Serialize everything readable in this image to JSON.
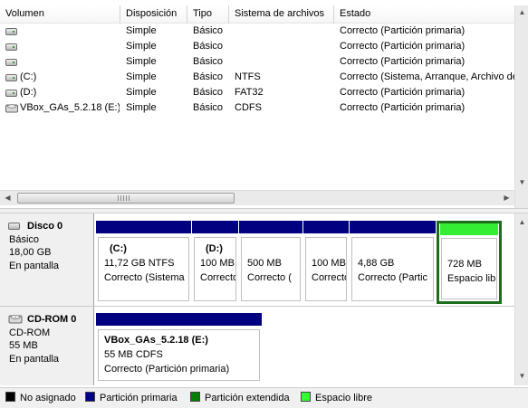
{
  "volume_table": {
    "columns": [
      "Volumen",
      "Disposición",
      "Tipo",
      "Sistema de archivos",
      "Estado"
    ],
    "rows": [
      {
        "icon": "drive-icon",
        "volume": "",
        "layout": "Simple",
        "type": "Básico",
        "fs": "",
        "status": "Correcto (Partición primaria)"
      },
      {
        "icon": "drive-icon",
        "volume": "",
        "layout": "Simple",
        "type": "Básico",
        "fs": "",
        "status": "Correcto (Partición primaria)"
      },
      {
        "icon": "drive-icon",
        "volume": "",
        "layout": "Simple",
        "type": "Básico",
        "fs": "",
        "status": "Correcto (Partición primaria)"
      },
      {
        "icon": "drive-icon",
        "volume": "(C:)",
        "layout": "Simple",
        "type": "Básico",
        "fs": "NTFS",
        "status": "Correcto (Sistema, Arranque, Archivo de"
      },
      {
        "icon": "drive-icon",
        "volume": "(D:)",
        "layout": "Simple",
        "type": "Básico",
        "fs": "FAT32",
        "status": "Correcto (Partición primaria)"
      },
      {
        "icon": "cdrom-icon",
        "volume": "VBox_GAs_5.2.18 (E:)",
        "layout": "Simple",
        "type": "Básico",
        "fs": "CDFS",
        "status": "Correcto (Partición primaria)"
      }
    ]
  },
  "disks": [
    {
      "name": "Disco 0",
      "kind": "Básico",
      "size": "18,00 GB",
      "state": "En pantalla",
      "partitions": [
        {
          "name": "(C:)",
          "size": "11,72 GB NTFS",
          "status": "Correcto (Sistema",
          "kind": "primary"
        },
        {
          "name": "(D:)",
          "size": "100 MB",
          "status": "Correcto",
          "kind": "primary"
        },
        {
          "name": "",
          "size": "500 MB",
          "status": "Correcto (",
          "kind": "primary"
        },
        {
          "name": "",
          "size": "100 MB",
          "status": "Correcto",
          "kind": "primary"
        },
        {
          "name": "",
          "size": "4,88 GB",
          "status": "Correcto (Partic",
          "kind": "primary"
        },
        {
          "name": "",
          "size": "728 MB",
          "status": "Espacio libre",
          "kind": "free"
        }
      ]
    },
    {
      "name": "CD-ROM 0",
      "kind": "CD-ROM",
      "size": "55 MB",
      "state": "En pantalla",
      "partitions": [
        {
          "name": "VBox_GAs_5.2.18 (E:)",
          "size": "55 MB CDFS",
          "status": "Correcto (Partición primaria)",
          "kind": "primary"
        }
      ]
    }
  ],
  "legend": [
    {
      "label": "No asignado",
      "color": "#000000"
    },
    {
      "label": "Partición primaria",
      "color": "#000080"
    },
    {
      "label": "Partición extendida",
      "color": "#008000"
    },
    {
      "label": "Espacio libre",
      "color": "#33ff33"
    }
  ],
  "colors": {
    "primary": "#000080",
    "free": "#33ee33",
    "free_frame": "#1e6e1e"
  }
}
